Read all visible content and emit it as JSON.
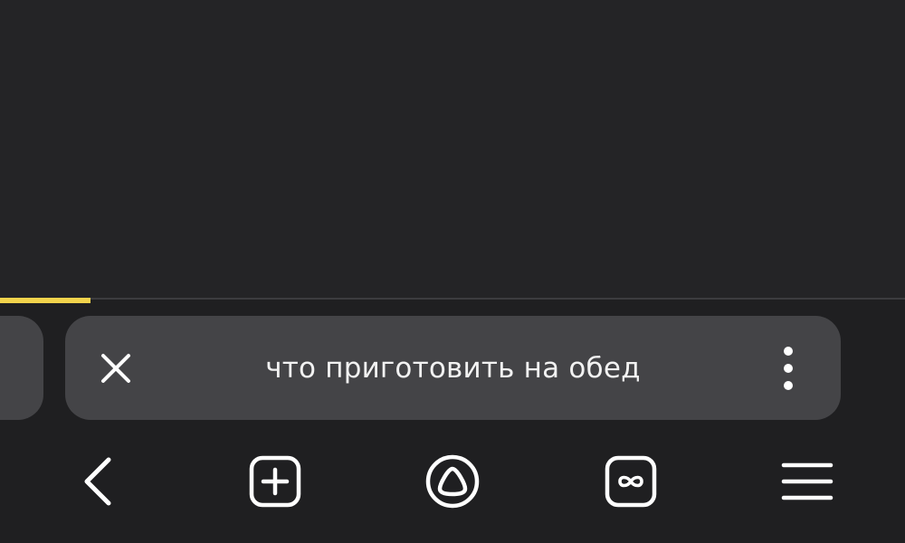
{
  "page": {
    "background": "#1f1f21",
    "content_background": "#242426"
  },
  "progress": {
    "value": 0.1,
    "color": "#f2d34c"
  },
  "omnibox": {
    "query": "что приготовить на обед",
    "close_icon": "close-icon",
    "more_icon": "more-vertical-icon",
    "background": "#444447"
  },
  "toolbar": {
    "items": [
      {
        "name": "back",
        "icon": "chevron-left-icon"
      },
      {
        "name": "new-tab",
        "icon": "plus-square-icon"
      },
      {
        "name": "alice",
        "icon": "alice-assistant-icon"
      },
      {
        "name": "tabs",
        "icon": "infinity-tabs-icon"
      },
      {
        "name": "menu",
        "icon": "hamburger-menu-icon"
      }
    ],
    "icon_color": "#ffffff"
  }
}
